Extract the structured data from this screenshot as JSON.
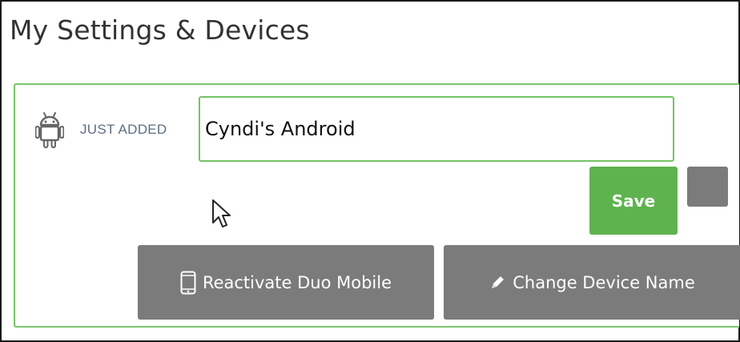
{
  "page": {
    "title": "My Settings & Devices"
  },
  "device": {
    "platform_icon": "android-icon",
    "status_label": "JUST ADDED",
    "name_value": "Cyndi's Android"
  },
  "actions": {
    "save_label": "Save",
    "cancel_icon": "square-icon",
    "reactivate": {
      "label": "Reactivate Duo Mobile",
      "icon": "phone-icon"
    },
    "change_name": {
      "label": "Change Device Name",
      "icon": "pencil-icon"
    }
  },
  "colors": {
    "accent_green": "#5fb34f",
    "border_green": "#7ac66a",
    "button_gray": "#7b7b7b",
    "status_text": "#5e6f83"
  }
}
